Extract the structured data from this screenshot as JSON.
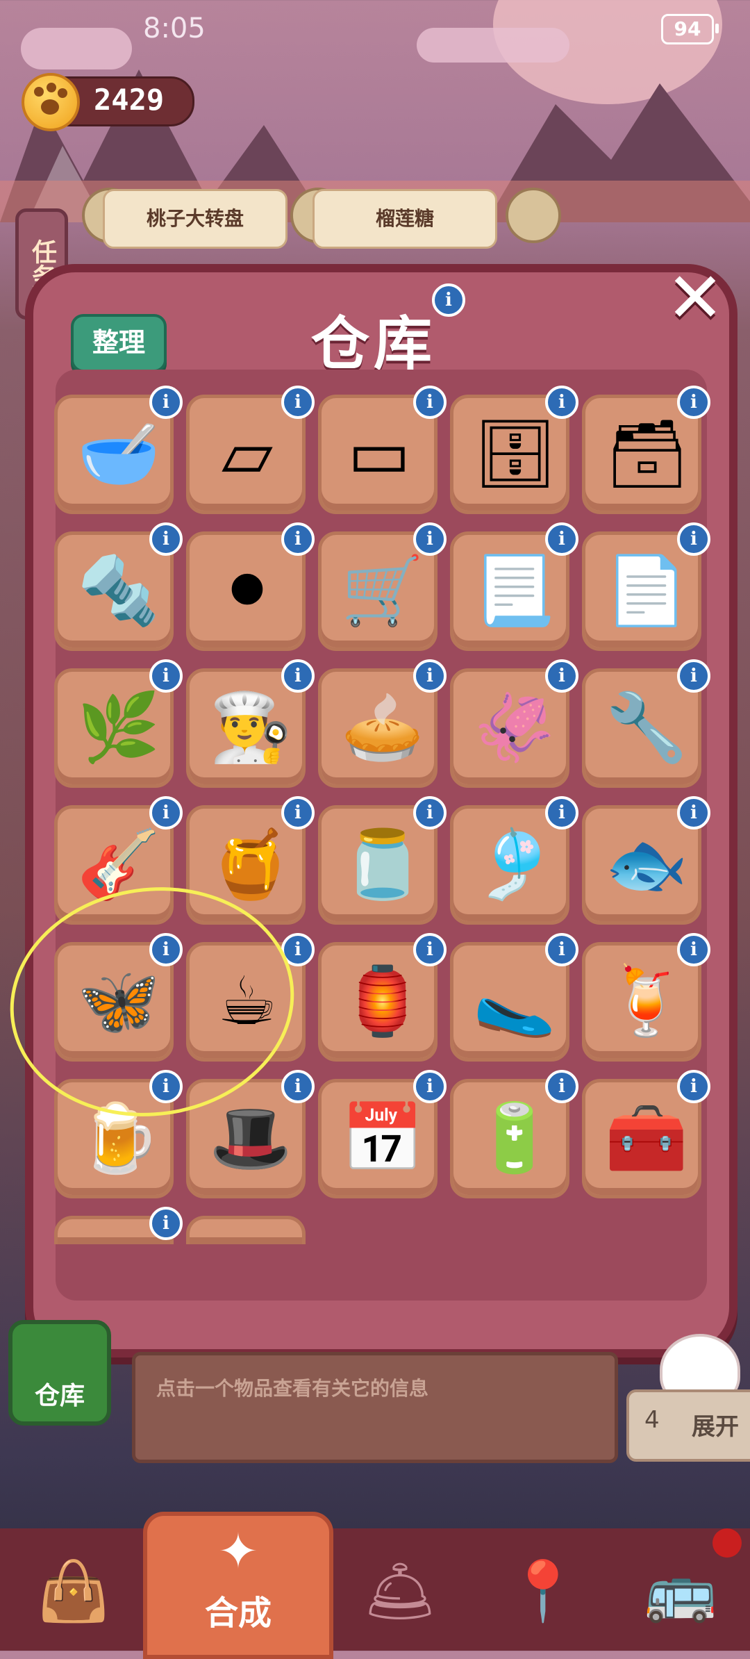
{
  "status_bar": {
    "time": "8:05",
    "battery": "94"
  },
  "currency": {
    "paw_coins": "2429"
  },
  "tasks": {
    "side_tab_label": "任务",
    "cards": [
      "桃子大转盘",
      "榴莲糖"
    ]
  },
  "modal": {
    "title": "仓库",
    "sort_button": "整理",
    "info_glyph": "i",
    "close_glyph": "✕",
    "items": [
      {
        "icon": "ceramic-pot-icon",
        "glyph": "🥣"
      },
      {
        "icon": "metal-sheets-icon",
        "glyph": "▱"
      },
      {
        "icon": "metal-plates-icon",
        "glyph": "▭"
      },
      {
        "icon": "safe-icon",
        "glyph": "🗄"
      },
      {
        "icon": "cabinet-icon",
        "glyph": "🗃"
      },
      {
        "icon": "hinges-icon",
        "glyph": "🔩"
      },
      {
        "icon": "tires-icon",
        "glyph": "⚫"
      },
      {
        "icon": "hand-truck-icon",
        "glyph": "🛒"
      },
      {
        "icon": "paper-strip-icon",
        "glyph": "📃"
      },
      {
        "icon": "paper-strips-icon",
        "glyph": "📄"
      },
      {
        "icon": "herb-sprig-icon",
        "glyph": "🌿"
      },
      {
        "icon": "chef-hat-icon",
        "glyph": "👨‍🍳"
      },
      {
        "icon": "tart-icon",
        "glyph": "🥧"
      },
      {
        "icon": "dried-squid-icon",
        "glyph": "🦑"
      },
      {
        "icon": "handle-icon",
        "glyph": "🔧"
      },
      {
        "icon": "guitar-icon",
        "glyph": "🎸"
      },
      {
        "icon": "caramel-drop-icon",
        "glyph": "🍯"
      },
      {
        "icon": "glass-jar-icon",
        "glyph": "🫙"
      },
      {
        "icon": "wind-chime-icon",
        "glyph": "🎐"
      },
      {
        "icon": "fish-icon",
        "glyph": "🐟"
      },
      {
        "icon": "butterfly-icon",
        "glyph": "🦋"
      },
      {
        "icon": "coffee-bean-sack-icon",
        "glyph": "☕"
      },
      {
        "icon": "tea-scroll-icon",
        "glyph": "🏮"
      },
      {
        "icon": "slipper-icon",
        "glyph": "🥿"
      },
      {
        "icon": "fruit-drink-icon",
        "glyph": "🍹"
      },
      {
        "icon": "fruit-mug-icon",
        "glyph": "🍺"
      },
      {
        "icon": "magic-hat-icon",
        "glyph": "🎩"
      },
      {
        "icon": "calendar-icon",
        "glyph": "📅"
      },
      {
        "icon": "battery-card-icon",
        "glyph": "🔋"
      },
      {
        "icon": "treasure-chest-icon",
        "glyph": "🧰"
      },
      {
        "icon": "empty-slot",
        "glyph": ""
      },
      {
        "icon": "empty-slot",
        "glyph": ""
      }
    ]
  },
  "bottom_panel": {
    "warehouse_label": "仓库",
    "hint_text": "点击一个物品查看有关它的信息",
    "expand_count": "4",
    "expand_label": "展开"
  },
  "nav": {
    "active_label": "合成",
    "items": [
      "shop-bag-icon",
      "merge-icon",
      "service-bell-icon",
      "map-icon",
      "bus-icon"
    ]
  }
}
